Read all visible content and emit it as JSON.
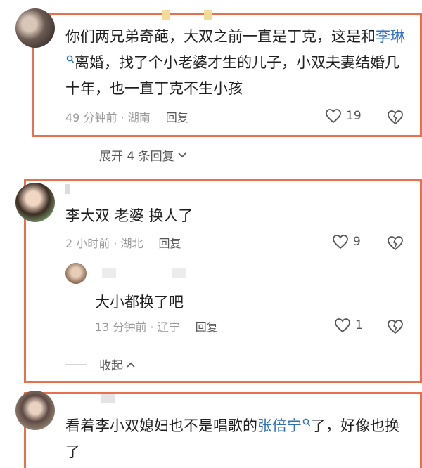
{
  "comments": [
    {
      "text_prefix": "你们两兄弟奇葩，大双之前一直是丁克，这是和",
      "link": "李琳",
      "text_suffix": "离婚，找了个小老婆才生的儿子，小双夫妻结婚几十年，也一直丁克不生小孩",
      "meta": "49 分钟前 · 湖南",
      "reply": "回复",
      "likes": "19",
      "expand": "展开 4 条回复"
    },
    {
      "text": "李大双  老婆  换人了",
      "meta": "2 小时前 · 湖北",
      "reply": "回复",
      "likes": "9"
    },
    {
      "text": "大小都换了吧",
      "meta": "13 分钟前 · 辽宁",
      "reply": "回复",
      "likes": "1",
      "collapse": "收起"
    },
    {
      "text_prefix": "看着李小双媳妇也不是唱歌的",
      "link": "张倍宁",
      "text_suffix": "了，好像也换了"
    }
  ],
  "colors": {
    "highlight_box": "#e9704f",
    "link": "#2f6fc0"
  },
  "icons": {
    "like": "heart-outline-icon",
    "dislike": "broken-heart-icon",
    "search": "search-magnifier-icon",
    "chevron": "chevron-icon"
  }
}
